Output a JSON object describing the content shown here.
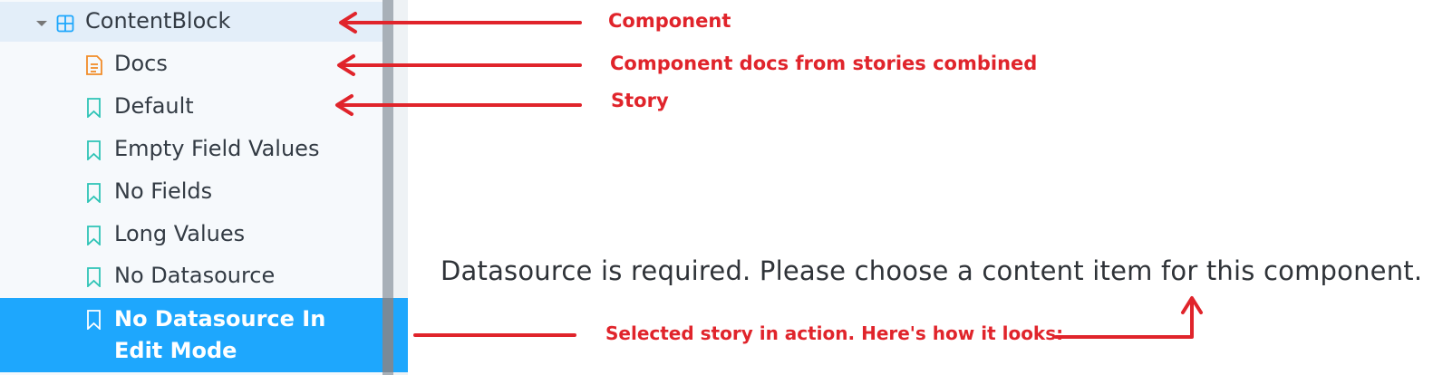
{
  "sidebar": {
    "component": {
      "label": "ContentBlock",
      "icon": "component-grid-icon"
    },
    "items": [
      {
        "label": "Docs",
        "icon": "docs-icon"
      },
      {
        "label": "Default",
        "icon": "bookmark-icon"
      },
      {
        "label": "Empty Field Values",
        "icon": "bookmark-icon"
      },
      {
        "label": "No Fields",
        "icon": "bookmark-icon"
      },
      {
        "label": "Long Values",
        "icon": "bookmark-icon"
      },
      {
        "label": "No Datasource",
        "icon": "bookmark-icon"
      },
      {
        "label": "No Datasource In Edit Mode",
        "icon": "bookmark-icon",
        "selected": true
      }
    ]
  },
  "preview": {
    "message": "Datasource is required. Please choose a content item for this component."
  },
  "annotations": {
    "component": "Component",
    "docs": "Component docs from stories combined",
    "story": "Story",
    "selected": "Selected story in action. Here's how it looks:"
  },
  "colors": {
    "accent": "#1ea7fd",
    "annotation": "#e0242b",
    "story_icon": "#2ec4b6",
    "docs_icon": "#f28c28",
    "component_icon": "#1ea7fd"
  }
}
